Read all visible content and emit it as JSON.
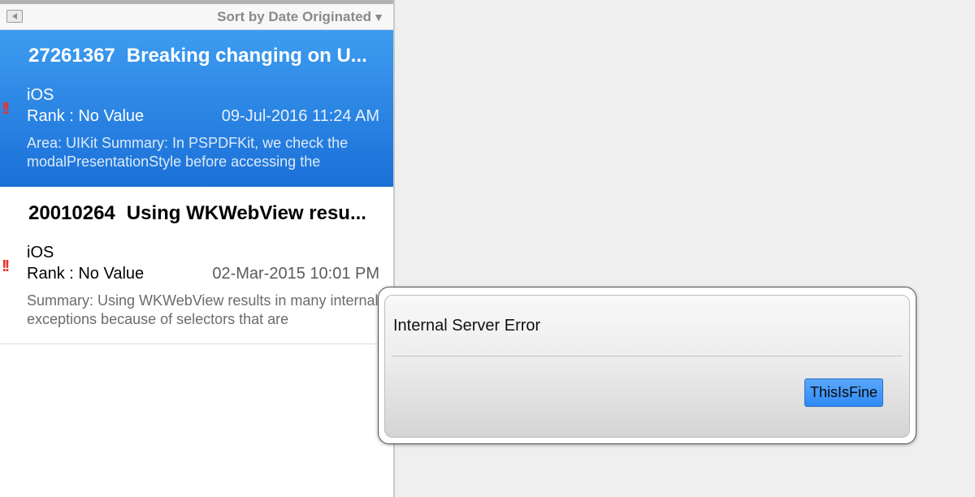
{
  "toolbar": {
    "collapse_icon": "collapse-left-icon",
    "sort_label": "Sort by Date Originated",
    "sort_arrow": "▼"
  },
  "items": [
    {
      "number": "27261367",
      "title": "Breaking changing on U...",
      "platform": "iOS",
      "rank": "Rank : No Value",
      "date": "09-Jul-2016 11:24 AM",
      "summary": "Area: UIKit Summary: In PSPDFKit, we check the modalPresentationStyle before accessing the",
      "flag": "!!",
      "selected": true
    },
    {
      "number": "20010264",
      "title": "Using WKWebView resu...",
      "platform": "iOS",
      "rank": "Rank : No Value",
      "date": "02-Mar-2015 10:01 PM",
      "summary": "Summary: Using WKWebView results in many internal exceptions because of selectors that are",
      "flag": "!!",
      "selected": false
    }
  ],
  "dialog": {
    "message": "Internal Server Error",
    "button_label": "ThisIsFine"
  },
  "colors": {
    "selection_blue": "#2a86e6",
    "flag_red": "#e8312a",
    "button_blue": "#3d95f8"
  }
}
